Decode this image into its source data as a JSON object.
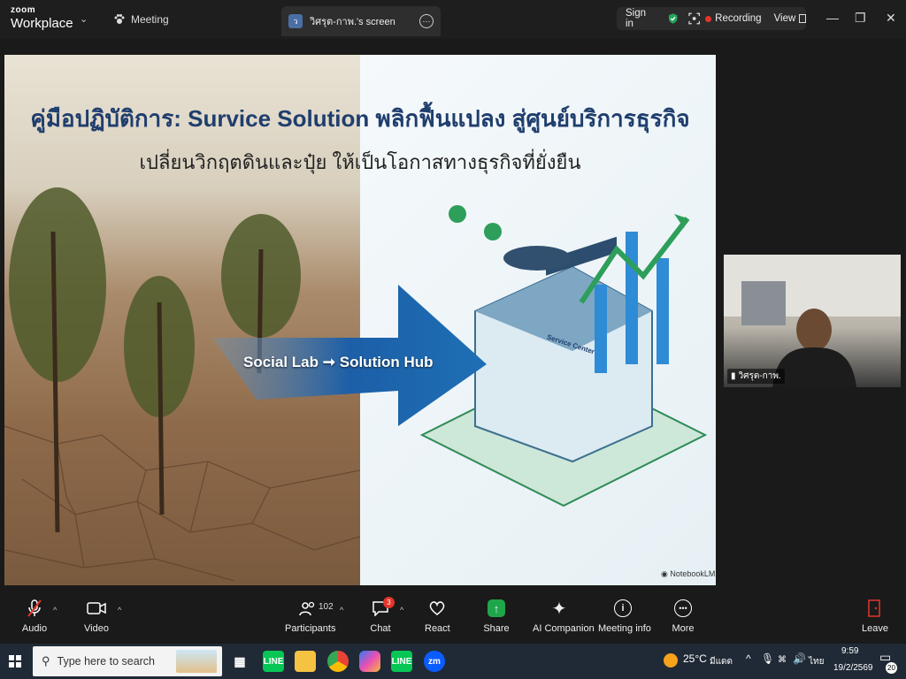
{
  "app": {
    "brand_top": "zoom",
    "brand_bottom": "Workplace"
  },
  "top": {
    "meeting_label": "Meeting",
    "share_tab_label": "วิศรุต-กาพ.'s screen",
    "share_tab_avatar": "ว",
    "sign_in": "Sign in",
    "recording": "Recording",
    "view": "View"
  },
  "slide": {
    "title": "คู่มือปฏิบัติการ: Survice Solution พลิกฟื้นแปลง สู่ศูนย์บริการธุรกิจ",
    "subtitle": "เปลี่ยนวิกฤตดินและปุ๋ย ให้เป็นโอกาสทางธุรกิจที่ยั่งยืน",
    "arrow_left": "Social Lab",
    "arrow_right": "Solution Hub",
    "building_sign": "Service Center",
    "watermark": "NotebookLM"
  },
  "video": {
    "name": "วิศรุต-กาพ."
  },
  "toolbar": {
    "audio": "Audio",
    "video": "Video",
    "participants": "Participants",
    "participants_count": "102",
    "chat": "Chat",
    "chat_badge": "3",
    "react": "React",
    "share": "Share",
    "ai_companion": "AI Companion",
    "meeting_info": "Meeting info",
    "more": "More",
    "leave": "Leave"
  },
  "taskbar": {
    "search_placeholder": "Type here to search",
    "weather": "25°C",
    "weather_desc": "มีแดด",
    "lang": "ไทย",
    "time": "9:59",
    "date": "19/2/2569",
    "notif_count": "20"
  },
  "colors": {
    "accent": "#0b5cff",
    "share_green": "#1fa64a",
    "record_red": "#e5352b"
  }
}
